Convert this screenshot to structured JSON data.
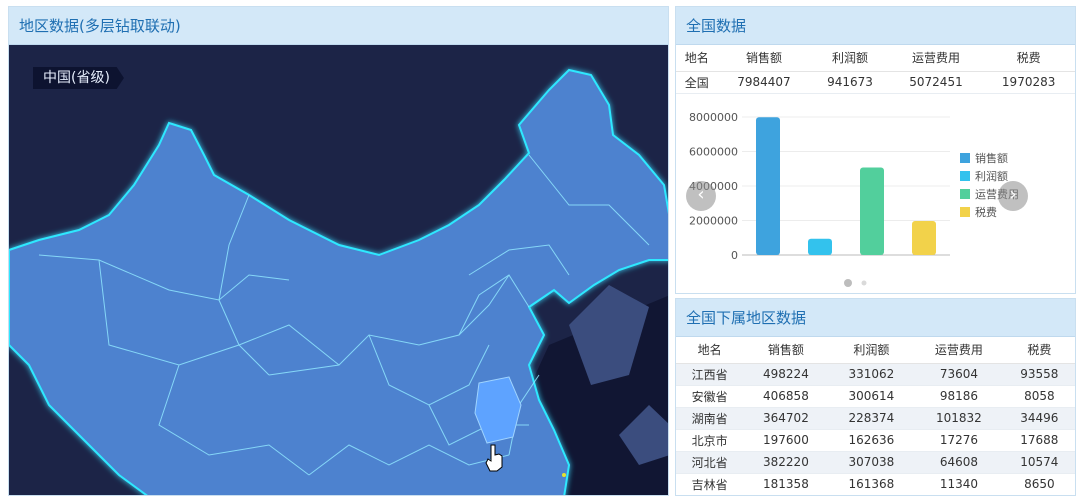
{
  "map_panel": {
    "title": "地区数据(多层钻取联动)",
    "level_tag": "中国(省级)"
  },
  "nation_panel": {
    "title": "全国数据",
    "columns": [
      "地名",
      "销售额",
      "利润额",
      "运营费用",
      "税费"
    ],
    "row": [
      "全国",
      "7984407",
      "941673",
      "5072451",
      "1970283"
    ],
    "prev_icon": "chevron-left-icon",
    "next_icon": "chevron-right-icon"
  },
  "chart_data": {
    "type": "bar",
    "categories": [
      "销售额",
      "利润额",
      "运营费用",
      "税费"
    ],
    "values": [
      7984407,
      941673,
      5072451,
      1970283
    ],
    "colors": [
      "#3ea3de",
      "#33c2ed",
      "#52cf9c",
      "#f2d24a"
    ],
    "yticks": [
      "0",
      "2000000",
      "4000000",
      "6000000",
      "8000000"
    ],
    "ylim": [
      0,
      8000000
    ],
    "legend": [
      "销售额",
      "利润额",
      "运营费用",
      "税费"
    ],
    "legend_position": "right"
  },
  "sub_panel": {
    "title": "全国下属地区数据",
    "columns": [
      "地名",
      "销售额",
      "利润额",
      "运营费用",
      "税费"
    ],
    "rows": [
      [
        "江西省",
        "498224",
        "331062",
        "73604",
        "93558"
      ],
      [
        "安徽省",
        "406858",
        "300614",
        "98186",
        "8058"
      ],
      [
        "湖南省",
        "364702",
        "228374",
        "101832",
        "34496"
      ],
      [
        "北京市",
        "197600",
        "162636",
        "17276",
        "17688"
      ],
      [
        "河北省",
        "382220",
        "307038",
        "64608",
        "10574"
      ],
      [
        "吉林省",
        "181358",
        "161368",
        "11340",
        "8650"
      ]
    ]
  }
}
